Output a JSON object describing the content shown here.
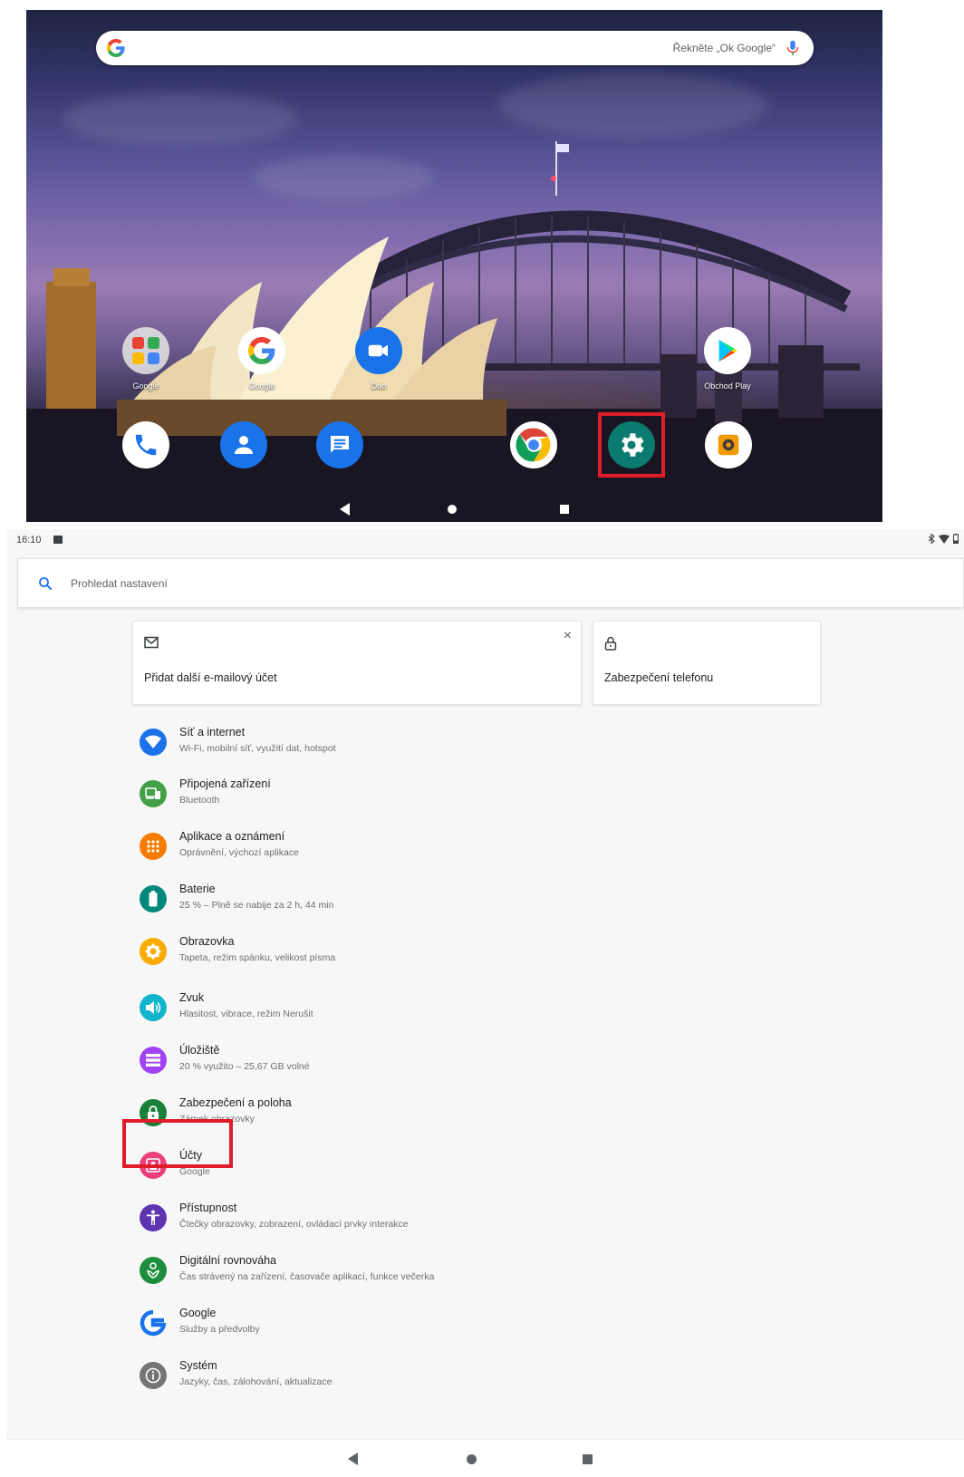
{
  "home_screen": {
    "search_bar": {
      "hint": "Řekněte „Ok Google“"
    },
    "apps_row1": [
      {
        "name": "google-folder",
        "label": "Google"
      },
      {
        "name": "google-app",
        "label": "Google"
      },
      {
        "name": "duo-app",
        "label": "Duo"
      },
      {
        "name": "play-store-app",
        "label": "Obchod Play"
      }
    ],
    "dock": [
      {
        "name": "phone-app"
      },
      {
        "name": "contacts-app"
      },
      {
        "name": "messages-app"
      },
      {
        "name": "chrome-app"
      },
      {
        "name": "settings-app",
        "highlighted": true
      },
      {
        "name": "camera-app"
      }
    ],
    "highlight_color": "#e01b2a"
  },
  "settings": {
    "status_bar": {
      "time": "16:10"
    },
    "search": {
      "placeholder": "Prohledat nastavení"
    },
    "cards": [
      {
        "icon": "mail-icon",
        "text": "Přidat další e-mailový účet",
        "dismiss": "×"
      },
      {
        "icon": "lock-icon",
        "text": "Zabezpečení telefonu"
      }
    ],
    "items": [
      {
        "title": "Síť a internet",
        "subtitle": "Wi-Fi, mobilní síť, využití dat, hotspot",
        "icon": "wifi-icon",
        "color": "#1a73e8"
      },
      {
        "title": "Připojená zařízení",
        "subtitle": "Bluetooth",
        "icon": "devices-icon",
        "color": "#43a047"
      },
      {
        "title": "Aplikace a oznámení",
        "subtitle": "Oprávnění, výchozí aplikace",
        "icon": "apps-icon",
        "color": "#f57c00"
      },
      {
        "title": "Baterie",
        "subtitle": "25 % – Plně se nabije za 2 h, 44 min",
        "icon": "battery-icon",
        "color": "#00897b"
      },
      {
        "title": "Obrazovka",
        "subtitle": "Tapeta, režim spánku, velikost písma",
        "icon": "display-icon",
        "color": "#f9ab00"
      },
      {
        "title": "Zvuk",
        "subtitle": "Hlasitost, vibrace, režim Nerušit",
        "icon": "sound-icon",
        "color": "#12b5cb"
      },
      {
        "title": "Úložiště",
        "subtitle": "20 % využito – 25,67 GB volné",
        "icon": "storage-icon",
        "color": "#a142f4"
      },
      {
        "title": "Zabezpečení a poloha",
        "subtitle": "Zámek obrazovky",
        "icon": "security-lock-icon",
        "color": "#188038"
      },
      {
        "title": "Účty",
        "subtitle": "Google",
        "icon": "accounts-icon",
        "color": "#ec407a",
        "highlighted": true
      },
      {
        "title": "Přístupnost",
        "subtitle": "Čtečky obrazovky, zobrazení, ovládací prvky interakce",
        "icon": "accessibility-icon",
        "color": "#5e35b1"
      },
      {
        "title": "Digitální rovnováha",
        "subtitle": "Čas strávený na zařízení, časovače aplikací, funkce večerka",
        "icon": "wellbeing-icon",
        "color": "#1e8e3e"
      },
      {
        "title": "Google",
        "subtitle": "Služby a předvolby",
        "icon": "google-g-icon",
        "color": "#1a73e8"
      },
      {
        "title": "Systém",
        "subtitle": "Jazyky, čas, zálohování, aktualizace",
        "icon": "info-icon",
        "color": "#757575"
      }
    ]
  }
}
